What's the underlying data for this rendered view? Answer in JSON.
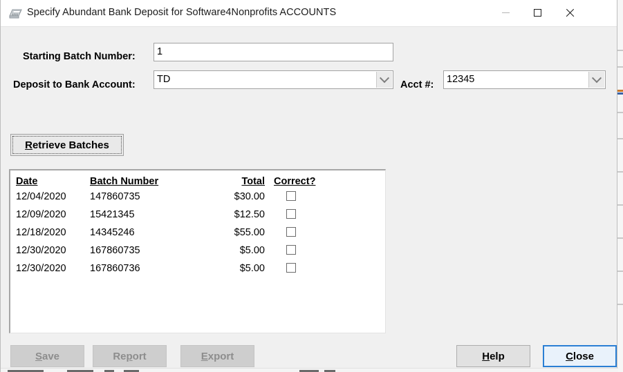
{
  "window": {
    "title": "Specify Abundant Bank Deposit for Software4Nonprofits ACCOUNTS",
    "icon": "adding-machine-icon",
    "controls": {
      "minimize": "minimize-icon",
      "maximize": "maximize-icon",
      "close": "close-icon"
    }
  },
  "form": {
    "starting_batch_label": "Starting Batch Number:",
    "starting_batch_value": "1",
    "deposit_account_label": "Deposit to Bank Account:",
    "deposit_account_value": "TD",
    "acct_label": "Acct #:",
    "acct_value": "12345",
    "retrieve_button": {
      "mnemonic": "R",
      "rest": "etrieve Batches"
    }
  },
  "table": {
    "columns": [
      "Date",
      "Batch Number",
      "Total",
      "Correct?"
    ],
    "rows": [
      {
        "date": "12/04/2020",
        "batch": "147860735",
        "total": "$30.00",
        "correct": false
      },
      {
        "date": "12/09/2020",
        "batch": "15421345",
        "total": "$12.50",
        "correct": false
      },
      {
        "date": "12/18/2020",
        "batch": "14345246",
        "total": "$55.00",
        "correct": false
      },
      {
        "date": "12/30/2020",
        "batch": "167860735",
        "total": "$5.00",
        "correct": false
      },
      {
        "date": "12/30/2020",
        "batch": "167860736",
        "total": "$5.00",
        "correct": false
      }
    ]
  },
  "buttons": {
    "save": {
      "pre": "",
      "mnemonic": "S",
      "post": "ave",
      "enabled": false
    },
    "report": {
      "pre": "Re",
      "mnemonic": "p",
      "post": "ort",
      "enabled": false
    },
    "export": {
      "pre": "",
      "mnemonic": "E",
      "post": "xport",
      "enabled": false
    },
    "help": {
      "pre": "",
      "mnemonic": "H",
      "post": "elp",
      "enabled": true
    },
    "close": {
      "pre": "",
      "mnemonic": "C",
      "post": "lose",
      "enabled": true,
      "default": true
    }
  },
  "colors": {
    "window_bg": "#f0f0f0",
    "titlebar_bg": "#ffffff",
    "default_button_border": "#2a7fd4",
    "field_border": "#a3a3a3",
    "disabled_text": "#8d8d8d"
  }
}
